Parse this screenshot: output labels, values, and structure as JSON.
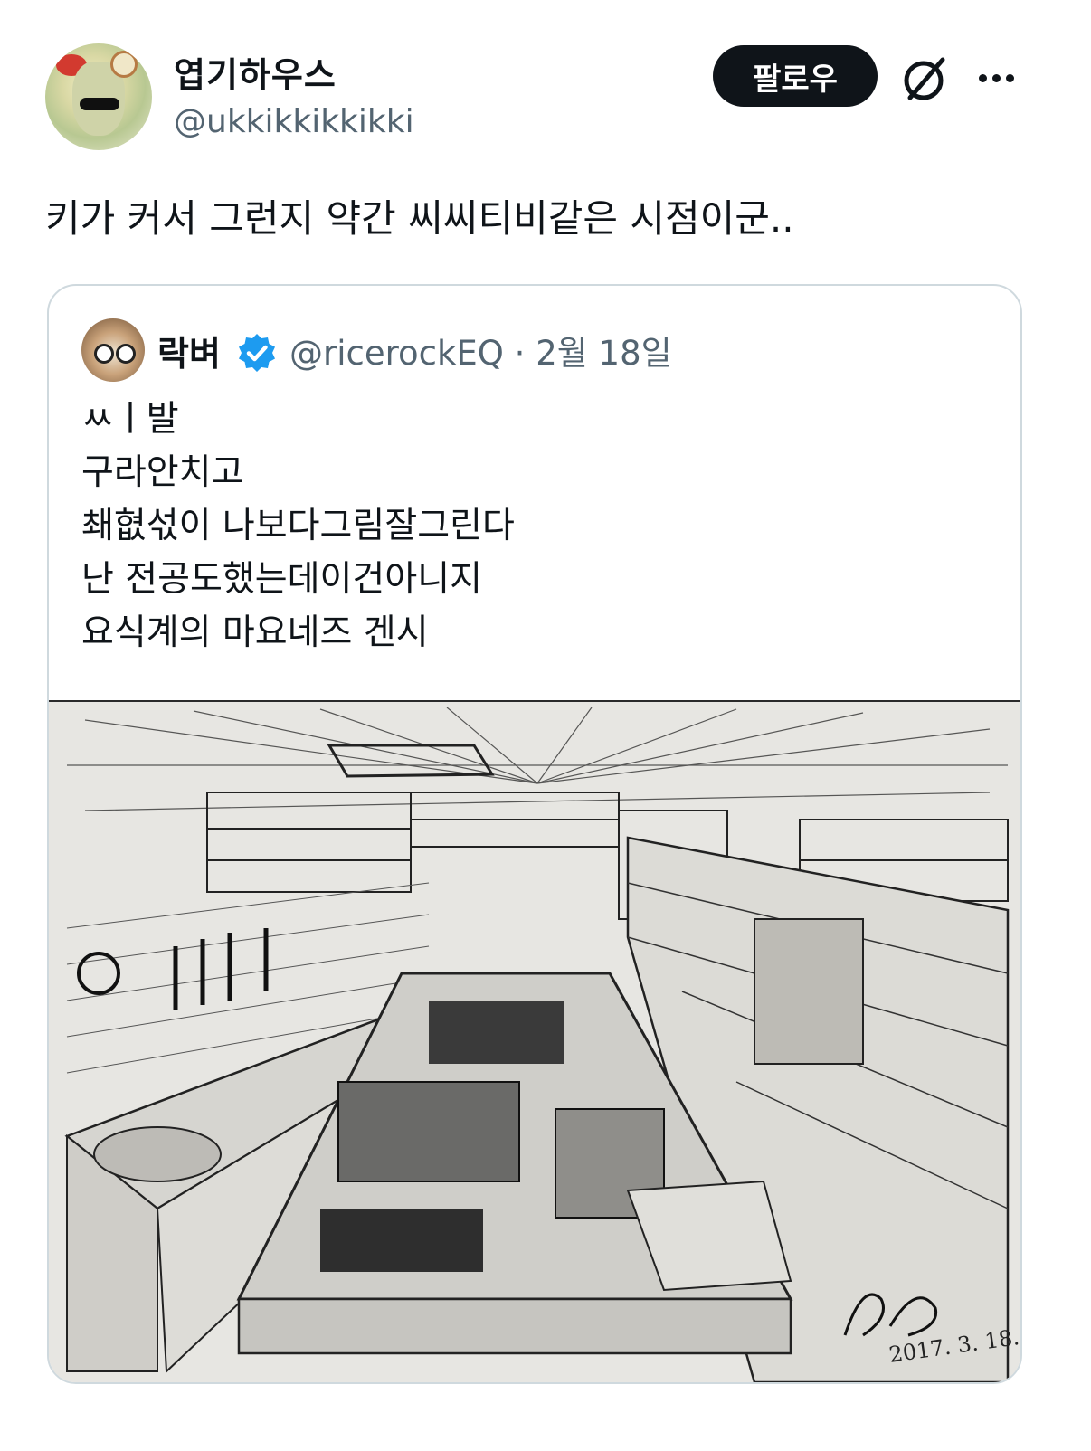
{
  "tweet": {
    "author": {
      "display_name": "엽기하우스",
      "handle": "@ukkikkikkikki"
    },
    "follow_label": "팔로우",
    "grok_icon": "grok-slash-icon",
    "more_icon": "more-horizontal-icon",
    "text": "키가 커서 그런지 약간 씨씨티비같은 시점이군.."
  },
  "quoted_tweet": {
    "author": {
      "display_name": "락벼",
      "verified": true,
      "handle_and_date": "@ricerockEQ · 2월 18일"
    },
    "lines": [
      "ㅆㅣ발",
      "구라안치고",
      "쵀혒섟이 나보다그림잘그린다",
      "난 전공도했는데이건아니지",
      "요식계의 마요네즈 겐시"
    ],
    "image": {
      "subject": "kitchen-sketch-illustration",
      "date_written": "2017. 3. 18."
    }
  },
  "colors": {
    "text": "#0f1419",
    "secondary": "#536471",
    "verified": "#1d9bf0",
    "border": "#cfd9de"
  }
}
